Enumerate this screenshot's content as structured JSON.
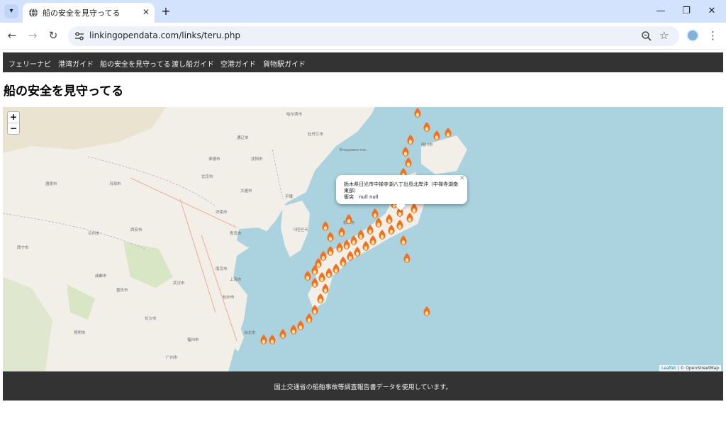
{
  "browser": {
    "tab_title": "船の安全を見守ってる",
    "url": "linkingopendata.com/links/teru.php"
  },
  "site": {
    "nav": [
      "フェリーナビ",
      "港湾ガイド",
      "船の安全を見守ってる",
      "渡し船ガイド",
      "空港ガイド",
      "貨物駅ガイド"
    ],
    "heading": "船の安全を見守ってる",
    "footer": "国土交通省の船舶事故等調査報告書データを使用しています。"
  },
  "map": {
    "zoom_in": "+",
    "zoom_out": "−",
    "attribution_leaflet": "Leaflet",
    "attribution_rest": "| © OpenStreetMap",
    "popup": {
      "line1": "栃木県日光市中禅寺湖八丁出島北岸沖（中禅寺湖南",
      "line2": "東部）",
      "line3": "衝突　null null"
    }
  },
  "colors": {
    "nav_bg": "#333333",
    "sea": "#aad3df",
    "land": "#f2efe9",
    "marker": "#f37021"
  }
}
